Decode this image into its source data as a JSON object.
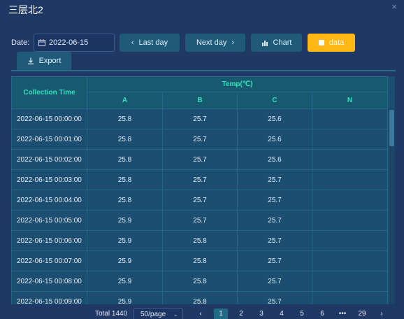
{
  "window": {
    "title": "三层北2",
    "close_icon": "×"
  },
  "toolbar": {
    "date_label": "Date:",
    "date_value": "2022-06-15",
    "last_day": "Last day",
    "next_day": "Next day",
    "chart": "Chart",
    "data": "data",
    "export": "Export"
  },
  "colors": {
    "accent": "#ffb716",
    "header_text": "#34e0bf",
    "button": "#1f5a78"
  },
  "table": {
    "col_time": "Collection Time",
    "group_header": "Temp(℃)",
    "cols": [
      "A",
      "B",
      "C",
      "N"
    ],
    "rows": [
      {
        "time": "2022-06-15 00:00:00",
        "a": "25.8",
        "b": "25.7",
        "c": "25.6",
        "n": ""
      },
      {
        "time": "2022-06-15 00:01:00",
        "a": "25.8",
        "b": "25.7",
        "c": "25.6",
        "n": ""
      },
      {
        "time": "2022-06-15 00:02:00",
        "a": "25.8",
        "b": "25.7",
        "c": "25.6",
        "n": ""
      },
      {
        "time": "2022-06-15 00:03:00",
        "a": "25.8",
        "b": "25.7",
        "c": "25.7",
        "n": ""
      },
      {
        "time": "2022-06-15 00:04:00",
        "a": "25.8",
        "b": "25.7",
        "c": "25.7",
        "n": ""
      },
      {
        "time": "2022-06-15 00:05:00",
        "a": "25.9",
        "b": "25.7",
        "c": "25.7",
        "n": ""
      },
      {
        "time": "2022-06-15 00:06:00",
        "a": "25.9",
        "b": "25.8",
        "c": "25.7",
        "n": ""
      },
      {
        "time": "2022-06-15 00:07:00",
        "a": "25.9",
        "b": "25.8",
        "c": "25.7",
        "n": ""
      },
      {
        "time": "2022-06-15 00:08:00",
        "a": "25.9",
        "b": "25.8",
        "c": "25.7",
        "n": ""
      },
      {
        "time": "2022-06-15 00:09:00",
        "a": "25.9",
        "b": "25.8",
        "c": "25.7",
        "n": ""
      }
    ]
  },
  "pager": {
    "total": "Total 1440",
    "page_size": "50/page",
    "prev": "‹",
    "pages": [
      "1",
      "2",
      "3",
      "4",
      "5",
      "6",
      "•••",
      "29"
    ],
    "next": "›",
    "current": "1"
  }
}
